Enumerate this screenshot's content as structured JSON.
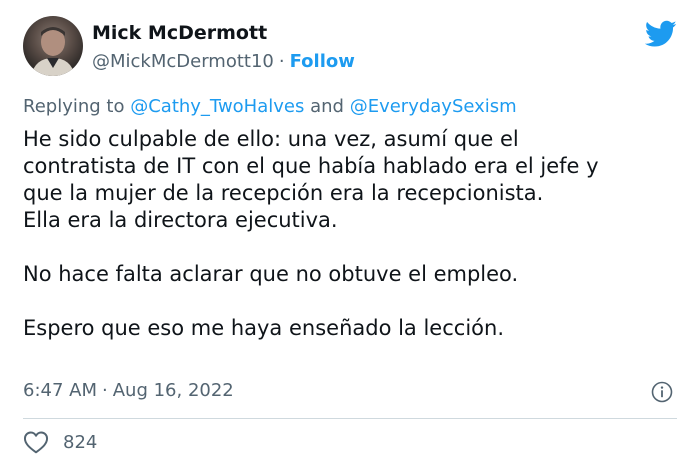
{
  "author": {
    "name": "Mick McDermott",
    "handle": "@MickMcDermott10",
    "follow_label": "Follow"
  },
  "reply_context": {
    "prefix": "Replying to",
    "mention_1": "@Cathy_TwoHalves",
    "conjunction": "and",
    "mention_2": "@EverydaySexism"
  },
  "tweet": {
    "lines": [
      "He sido culpable de ello: una vez, asumí que el",
      "contratista de IT con el que había hablado era el jefe y",
      "que la mujer de la recepción era la recepcionista.",
      "Ella era la directora ejecutiva.",
      "No hace falta aclarar que no obtuve el empleo.",
      "Espero que eso me haya enseñado la lección."
    ]
  },
  "meta": {
    "time": "6:47 AM",
    "separator": "·",
    "date": "Aug 16, 2022"
  },
  "engagement": {
    "likes": "824"
  },
  "colors": {
    "accent": "#1d9bf0",
    "secondary_text": "#536471",
    "primary_text": "#0f1419",
    "divider": "#cfd9de"
  },
  "icons": {
    "brand": "twitter-bird-icon",
    "info": "info-icon",
    "like": "heart-icon"
  }
}
